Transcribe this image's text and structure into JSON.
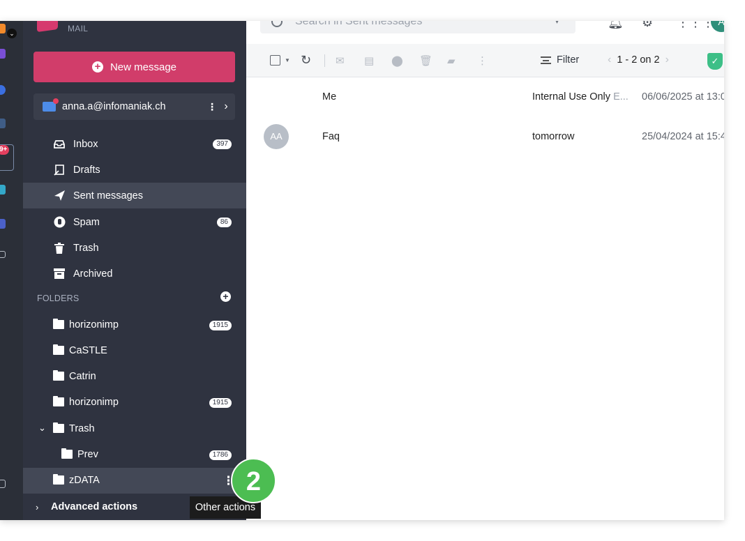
{
  "brand": {
    "product_label": "MAIL",
    "accent": "#d13d6a"
  },
  "rail": {
    "notification_badge": "9+"
  },
  "sidebar": {
    "new_message_label": "New message",
    "account_email": "anna.a@infomaniak.ch",
    "nav_items": [
      {
        "label": "Inbox",
        "icon": "inbox-icon",
        "count": "397"
      },
      {
        "label": "Drafts",
        "icon": "drafts-icon",
        "count": ""
      },
      {
        "label": "Sent messages",
        "icon": "send-icon",
        "count": "",
        "active": true
      },
      {
        "label": "Spam",
        "icon": "spam-icon",
        "count": "86"
      },
      {
        "label": "Trash",
        "icon": "trash-icon",
        "count": ""
      },
      {
        "label": "Archived",
        "icon": "archive-icon",
        "count": ""
      }
    ],
    "folders_heading": "FOLDERS",
    "folders": [
      {
        "label": "horizonimp",
        "count": "1915"
      },
      {
        "label": "CaSTLE",
        "count": ""
      },
      {
        "label": "Catrin",
        "count": ""
      },
      {
        "label": "horizonimp",
        "count": "1915"
      },
      {
        "label": "Trash",
        "count": "",
        "expanded": true
      },
      {
        "label": "Prev",
        "count": "1786"
      },
      {
        "label": "zDATA",
        "count": ""
      }
    ],
    "advanced_label": "Advanced actions"
  },
  "header": {
    "search_placeholder": "Search in Sent messages",
    "avatar_initial": "A"
  },
  "toolbar": {
    "filter_label": "Filter",
    "pagination": "1 - 2 on 2"
  },
  "messages": [
    {
      "sender": "Me",
      "subject": "Internal Use Only",
      "preview": "E...",
      "date": "06/06/2025 at 13:0",
      "avatar": ""
    },
    {
      "sender": "Faq",
      "subject": "tomorrow",
      "preview": "",
      "date": "25/04/2024 at 15:4",
      "avatar": "AA"
    }
  ],
  "tooltip": {
    "text": "Other actions"
  },
  "step_marker": "2"
}
